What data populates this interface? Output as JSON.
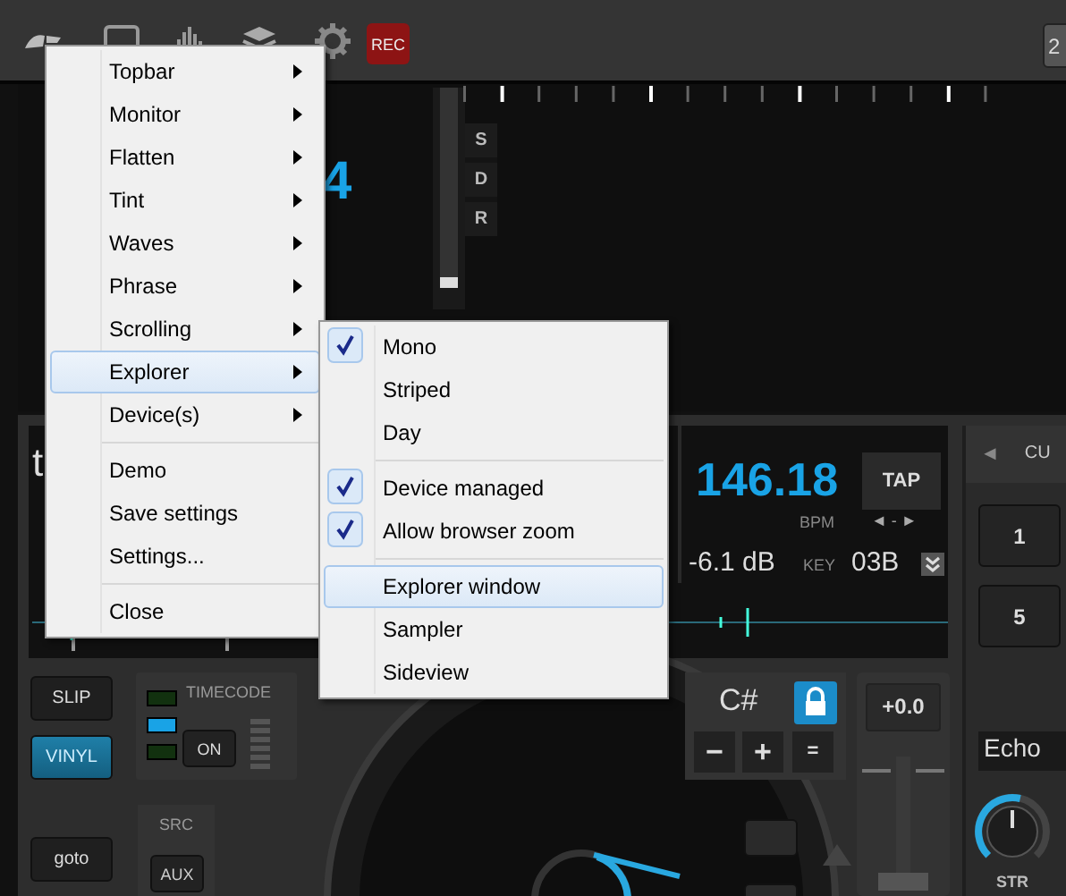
{
  "topbar": {
    "rec": "REC",
    "deck_button": "2"
  },
  "overview": {
    "big_digit": "4",
    "zoom": {
      "level": 0.9
    },
    "side_buttons": [
      "S",
      "D",
      "R"
    ]
  },
  "deck": {
    "title": "t",
    "bpm": "146.18",
    "bpm_label": "BPM",
    "tap": "TAP",
    "nudge": "◄ - ►",
    "gain": "-6.1 dB",
    "key_label": "KEY",
    "key": "03B",
    "pitch_key": "C#",
    "key_lock": true,
    "key_buttons": [
      "−",
      "+",
      "="
    ],
    "pitch": "+0.0",
    "buttons": [
      {
        "label": "SLIP",
        "selected": false
      },
      {
        "label": "VINYL",
        "selected": true
      }
    ],
    "timecode": {
      "label": "TIMECODE",
      "button": "ON",
      "leds": [
        false,
        true,
        false
      ]
    },
    "src": {
      "label": "SRC",
      "button": "AUX"
    },
    "goto": "goto"
  },
  "cues": {
    "arrow": "◄",
    "label": "CU",
    "pads": [
      "1",
      "5"
    ]
  },
  "fx": {
    "name": "Echo",
    "knob": {
      "label": "STR",
      "level": 0.55
    }
  },
  "menu": {
    "items": [
      {
        "kind": "submenu",
        "label": "Topbar",
        "selected": false
      },
      {
        "kind": "submenu",
        "label": "Monitor",
        "selected": false
      },
      {
        "kind": "submenu",
        "label": "Flatten",
        "selected": false
      },
      {
        "kind": "submenu",
        "label": "Tint",
        "selected": false
      },
      {
        "kind": "submenu",
        "label": "Waves",
        "selected": false
      },
      {
        "kind": "submenu",
        "label": "Phrase",
        "selected": false
      },
      {
        "kind": "submenu",
        "label": "Scrolling",
        "selected": false
      },
      {
        "kind": "submenu",
        "label": "Explorer",
        "selected": true
      },
      {
        "kind": "submenu",
        "label": "Device(s)",
        "selected": false
      },
      {
        "kind": "separator"
      },
      {
        "kind": "action",
        "label": "Demo",
        "selected": false
      },
      {
        "kind": "action",
        "label": "Save settings",
        "selected": false
      },
      {
        "kind": "action",
        "label": "Settings...",
        "selected": false
      },
      {
        "kind": "separator"
      },
      {
        "kind": "action",
        "label": "Close",
        "selected": false
      }
    ]
  },
  "submenu": {
    "items": [
      {
        "kind": "check",
        "label": "Mono",
        "checked": true,
        "selected": false
      },
      {
        "kind": "check",
        "label": "Striped",
        "checked": false,
        "selected": false
      },
      {
        "kind": "check",
        "label": "Day",
        "checked": false,
        "selected": false
      },
      {
        "kind": "separator"
      },
      {
        "kind": "check",
        "label": "Device managed",
        "checked": true,
        "selected": false
      },
      {
        "kind": "check",
        "label": "Allow browser zoom",
        "checked": true,
        "selected": false
      },
      {
        "kind": "separator"
      },
      {
        "kind": "action",
        "label": "Explorer window",
        "selected": true
      },
      {
        "kind": "action",
        "label": "Sampler",
        "selected": false
      },
      {
        "kind": "action",
        "label": "Sideview",
        "selected": false
      }
    ]
  }
}
